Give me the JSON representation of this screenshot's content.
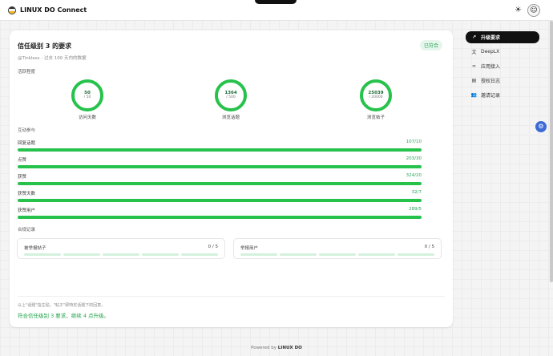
{
  "header": {
    "title": "LINUX DO Connect",
    "avatar_glyph": "☺",
    "theme_icon": "☀"
  },
  "card": {
    "title": "信任级别 3 的要求",
    "badge": "已符合",
    "subtitle": "@Tinkless - 过去 100 天内的数据",
    "activity_label": "活跃程度",
    "rings": [
      {
        "value": "50",
        "total": "/ 50",
        "label": "访问天数",
        "percent": 100
      },
      {
        "value": "1364",
        "total": "/ 500",
        "label": "浏览话题",
        "percent": 100
      },
      {
        "value": "25039",
        "total": "/ 20000",
        "label": "浏览帖子",
        "percent": 100
      }
    ],
    "interaction_label": "互动参与",
    "metrics": [
      {
        "name": "回复话题",
        "value": "107/10",
        "percent": 100
      },
      {
        "name": "点赞",
        "value": "203/30",
        "percent": 100
      },
      {
        "name": "获赞",
        "value": "324/20",
        "percent": 100
      },
      {
        "name": "获赞天数",
        "value": "32/7",
        "percent": 100
      },
      {
        "name": "获赞用户",
        "value": "289/5",
        "percent": 100
      }
    ],
    "compliance_label": "合规记录",
    "compliance": [
      {
        "name": "被举报帖子",
        "value": "0 / 5"
      },
      {
        "name": "举报用户",
        "value": "0 / 5"
      }
    ],
    "note": "以上\"话题\"指主贴，\"帖子\"即特定话题下的回复。",
    "result": "符合信任级别 3 要求，继续 4 点升级。"
  },
  "sidebar": {
    "items": [
      {
        "label": "升级要求",
        "icon": "↗",
        "active": true
      },
      {
        "label": "DeepLX",
        "icon": "文"
      },
      {
        "label": "应用接入",
        "icon": "∞"
      },
      {
        "label": "授权日志",
        "icon": "▤"
      },
      {
        "label": "邀请记录",
        "icon": "👥"
      }
    ]
  },
  "float_button": {
    "icon": "⚙"
  },
  "footer": {
    "prefix": "Powered by",
    "brand": "LINUX DO"
  },
  "colors": {
    "accent": "#27c24c",
    "result": "#1fa34a",
    "float": "#3d6bd6"
  }
}
